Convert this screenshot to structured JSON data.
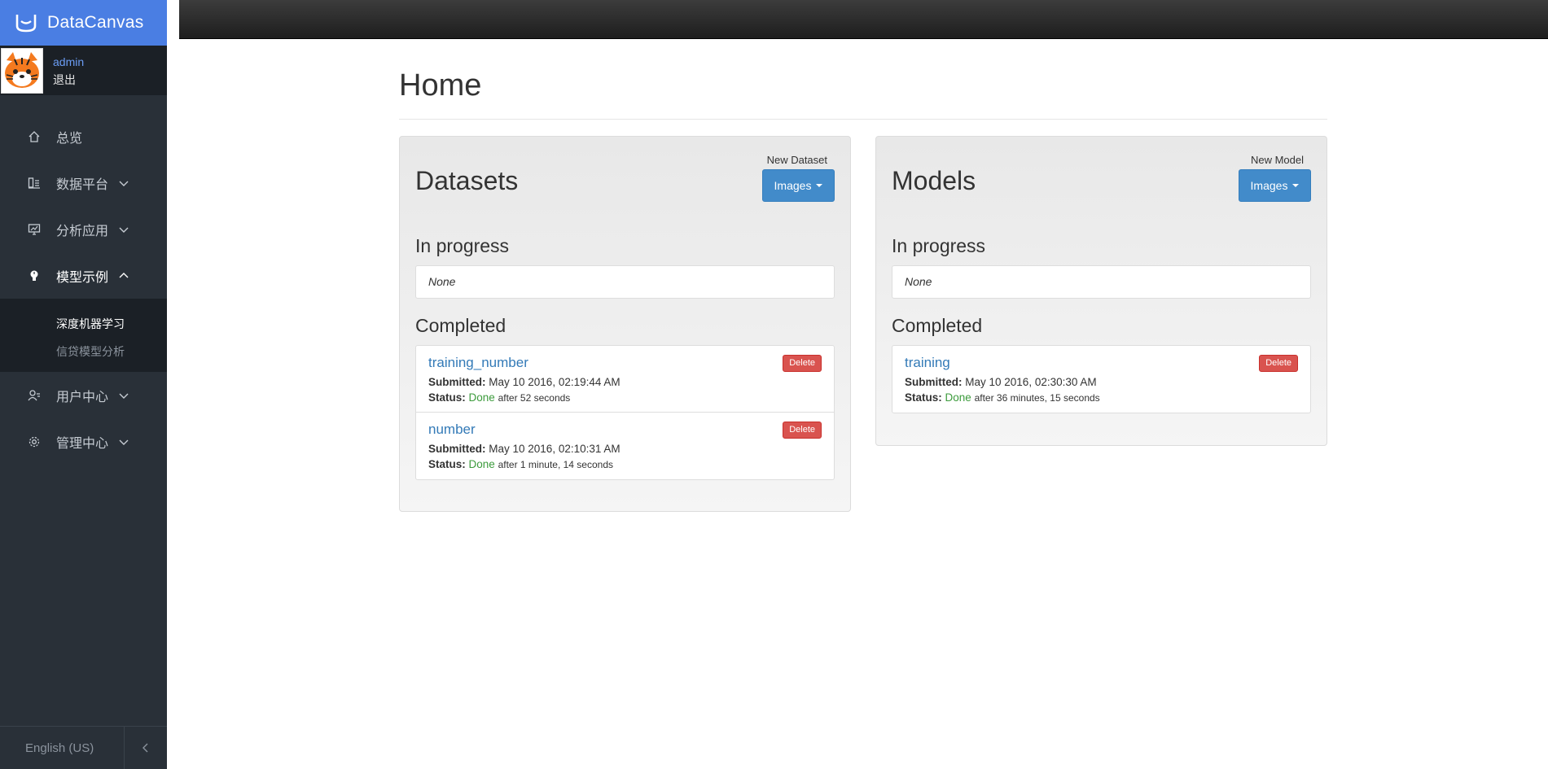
{
  "brand": {
    "name": "DataCanvas"
  },
  "user": {
    "name": "admin",
    "logout": "退出"
  },
  "sidebar": {
    "items": [
      {
        "label": "总览",
        "icon": "home-icon"
      },
      {
        "label": "数据平台",
        "icon": "data-platform-icon"
      },
      {
        "label": "分析应用",
        "icon": "analysis-icon"
      },
      {
        "label": "模型示例",
        "icon": "lightbulb-icon"
      },
      {
        "label": "用户中心",
        "icon": "user-icon"
      },
      {
        "label": "管理中心",
        "icon": "gear-icon"
      }
    ],
    "subitems": [
      {
        "label": "深度机器学习"
      },
      {
        "label": "信贷模型分析"
      }
    ],
    "language": "English (US)"
  },
  "main": {
    "title": "Home",
    "datasets": {
      "title": "Datasets",
      "new_label": "New Dataset",
      "button_label": "Images",
      "in_progress_title": "In progress",
      "in_progress_empty": "None",
      "completed_title": "Completed",
      "jobs": [
        {
          "name": "training_number",
          "submitted_label": "Submitted:",
          "submitted": "May 10 2016, 02:19:44 AM",
          "status_label": "Status:",
          "status": "Done",
          "duration": "after 52 seconds",
          "delete_label": "Delete"
        },
        {
          "name": "number",
          "submitted_label": "Submitted:",
          "submitted": "May 10 2016, 02:10:31 AM",
          "status_label": "Status:",
          "status": "Done",
          "duration": "after 1 minute, 14 seconds",
          "delete_label": "Delete"
        }
      ]
    },
    "models": {
      "title": "Models",
      "new_label": "New Model",
      "button_label": "Images",
      "in_progress_title": "In progress",
      "in_progress_empty": "None",
      "completed_title": "Completed",
      "jobs": [
        {
          "name": "training",
          "submitted_label": "Submitted:",
          "submitted": "May 10 2016, 02:30:30 AM",
          "status_label": "Status:",
          "status": "Done",
          "duration": "after 36 minutes, 15 seconds",
          "delete_label": "Delete"
        }
      ]
    }
  },
  "colors": {
    "brand": "#4a7ee3",
    "sidebar": "#293038",
    "primary": "#428bca",
    "danger": "#d9534f",
    "success": "#3c9b3c"
  }
}
